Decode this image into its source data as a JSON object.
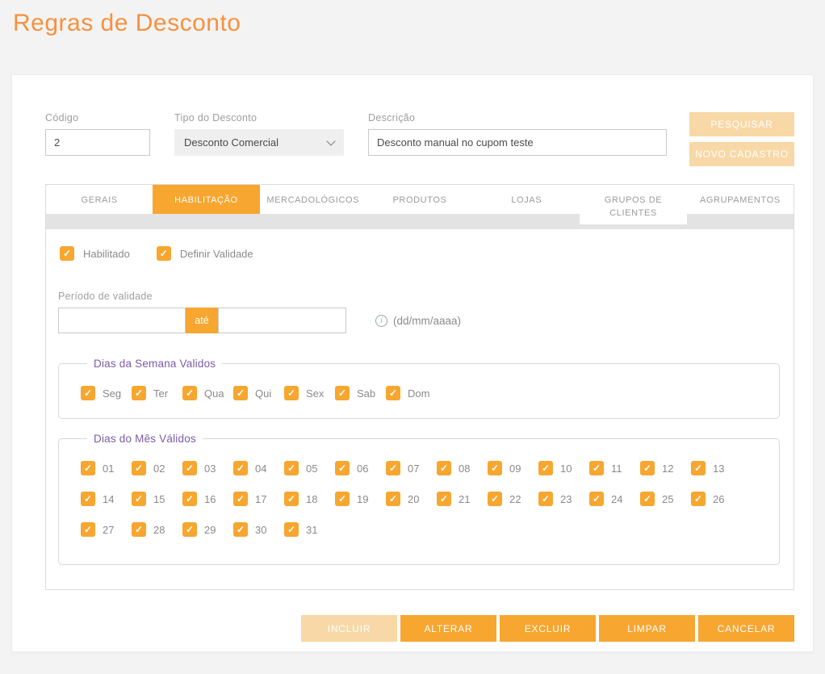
{
  "page": {
    "title": "Regras de Desconto"
  },
  "form": {
    "codigo": {
      "label": "Código",
      "value": "2"
    },
    "tipo": {
      "label": "Tipo do Desconto",
      "value": "Desconto Comercial"
    },
    "descricao": {
      "label": "Descrição",
      "value": "Desconto manual no cupom teste"
    },
    "actions": {
      "pesquisar": "PESQUISAR",
      "novo_cadastro": "NOVO CADASTRO"
    }
  },
  "tabs": [
    {
      "label": "GERAIS",
      "active": false
    },
    {
      "label": "HABILITAÇÃO",
      "active": true
    },
    {
      "label": "MERCADOLÓGICOS",
      "active": false
    },
    {
      "label": "PRODUTOS",
      "active": false
    },
    {
      "label": "LOJAS",
      "active": false
    },
    {
      "label": "GRUPOS DE CLIENTES",
      "active": false
    },
    {
      "label": "AGRUPAMENTOS",
      "active": false
    }
  ],
  "habilitacao": {
    "checkboxes": [
      {
        "label": "Habilitado",
        "checked": true
      },
      {
        "label": "Definir Validade",
        "checked": true
      }
    ],
    "periodo": {
      "label": "Período de validade",
      "from_value": "",
      "to_value": "",
      "ate_label": "até",
      "hint": "(dd/mm/aaaa)"
    },
    "week": {
      "legend": "Dias da Semana Validos",
      "days": [
        "Seg",
        "Ter",
        "Qua",
        "Qui",
        "Sex",
        "Sab",
        "Dom"
      ]
    },
    "month": {
      "legend": "Dias do Mês Válidos",
      "days": [
        "01",
        "02",
        "03",
        "04",
        "05",
        "06",
        "07",
        "08",
        "09",
        "10",
        "11",
        "12",
        "13",
        "14",
        "15",
        "16",
        "17",
        "18",
        "19",
        "20",
        "21",
        "22",
        "23",
        "24",
        "25",
        "26",
        "27",
        "28",
        "29",
        "30",
        "31"
      ]
    }
  },
  "footer_buttons": [
    {
      "label": "INCLUIR",
      "disabled": true
    },
    {
      "label": "ALTERAR",
      "disabled": false
    },
    {
      "label": "EXCLUIR",
      "disabled": false
    },
    {
      "label": "LIMPAR",
      "disabled": false
    },
    {
      "label": "CANCELAR",
      "disabled": false
    }
  ],
  "icons": {
    "checkmark": "✓",
    "info": "i"
  },
  "colors": {
    "primary": "#F7A62F",
    "pale": "#F8D8A6",
    "title": "#F6913E",
    "legend": "#7B5BA6"
  }
}
